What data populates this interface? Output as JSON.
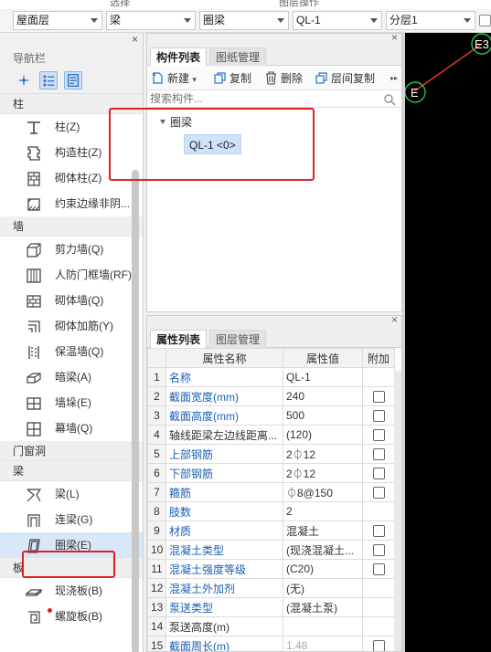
{
  "topstrip": {
    "left_label": "选择",
    "right_label": "图层操作"
  },
  "dropdowns": [
    {
      "value": "屋面层"
    },
    {
      "value": "梁"
    },
    {
      "value": "圈梁"
    },
    {
      "value": "QL-1"
    },
    {
      "value": "分层1"
    }
  ],
  "nav": {
    "close": "×",
    "title": "导航栏",
    "sections": [
      {
        "label": "柱",
        "items": [
          "柱(Z)",
          "构造柱(Z)",
          "砌体柱(Z)",
          "约束边缘非阴..."
        ]
      },
      {
        "label": "墙",
        "items": [
          "剪力墙(Q)",
          "人防门框墙(RF)",
          "砌体墙(Q)",
          "砌体加筋(Y)",
          "保温墙(Q)",
          "暗梁(A)",
          "墙垛(E)",
          "幕墙(Q)"
        ]
      },
      {
        "label": "门窗洞",
        "items": []
      },
      {
        "label": "梁",
        "items": [
          "梁(L)",
          "连梁(G)",
          "圈梁(E)"
        ]
      },
      {
        "label": "板",
        "items": [
          "现浇板(B)",
          "螺旋板(B)"
        ]
      }
    ]
  },
  "component_panel": {
    "close": "×",
    "tabs": [
      "构件列表",
      "图纸管理"
    ],
    "toolbar": {
      "new": "新建",
      "copy": "复制",
      "delete": "删除",
      "floor_copy": "层间复制",
      "more": "▸▸"
    },
    "search_placeholder": "搜索构件...",
    "tree": {
      "root": "圈梁",
      "leaf": "QL-1 <0>"
    }
  },
  "property_panel": {
    "close": "×",
    "tabs": [
      "属性列表",
      "图层管理"
    ],
    "columns": [
      "属性名称",
      "属性值",
      "附加"
    ],
    "rows": [
      {
        "no": "1",
        "name": "名称",
        "value": "QL-1",
        "blue": true,
        "check": false
      },
      {
        "no": "2",
        "name": "截面宽度(mm)",
        "value": "240",
        "blue": true,
        "check": true
      },
      {
        "no": "3",
        "name": "截面高度(mm)",
        "value": "500",
        "blue": true,
        "check": true
      },
      {
        "no": "4",
        "name": "轴线距梁左边线距离...",
        "value": "(120)",
        "blue": false,
        "check": true
      },
      {
        "no": "5",
        "name": "上部钢筋",
        "value": "2⏀12",
        "blue": true,
        "check": true
      },
      {
        "no": "6",
        "name": "下部钢筋",
        "value": "2⏀12",
        "blue": true,
        "check": true
      },
      {
        "no": "7",
        "name": "箍筋",
        "value": "⏀8@150",
        "blue": true,
        "check": true
      },
      {
        "no": "8",
        "name": "肢数",
        "value": "2",
        "blue": true,
        "check": false
      },
      {
        "no": "9",
        "name": "材质",
        "value": "混凝土",
        "blue": true,
        "check": true
      },
      {
        "no": "10",
        "name": "混凝土类型",
        "value": "(现浇混凝土...",
        "blue": true,
        "check": true
      },
      {
        "no": "11",
        "name": "混凝土强度等级",
        "value": "(C20)",
        "blue": true,
        "check": true
      },
      {
        "no": "12",
        "name": "混凝土外加剂",
        "value": "(无)",
        "blue": true,
        "check": false
      },
      {
        "no": "13",
        "name": "泵送类型",
        "value": "(混凝土泵)",
        "blue": true,
        "check": false
      },
      {
        "no": "14",
        "name": "泵送高度(m)",
        "value": "",
        "blue": false,
        "check": false
      },
      {
        "no": "15",
        "name": "截面周长(m)",
        "value": "1.48",
        "blue": true,
        "check": true,
        "grey": true
      }
    ]
  },
  "canvas": {
    "marker_top": "E3",
    "marker_left": "E"
  },
  "colors": {
    "highlight_red": "#e02020",
    "link_blue": "#1a5fb4",
    "selection_blue": "#d9e8f8"
  }
}
